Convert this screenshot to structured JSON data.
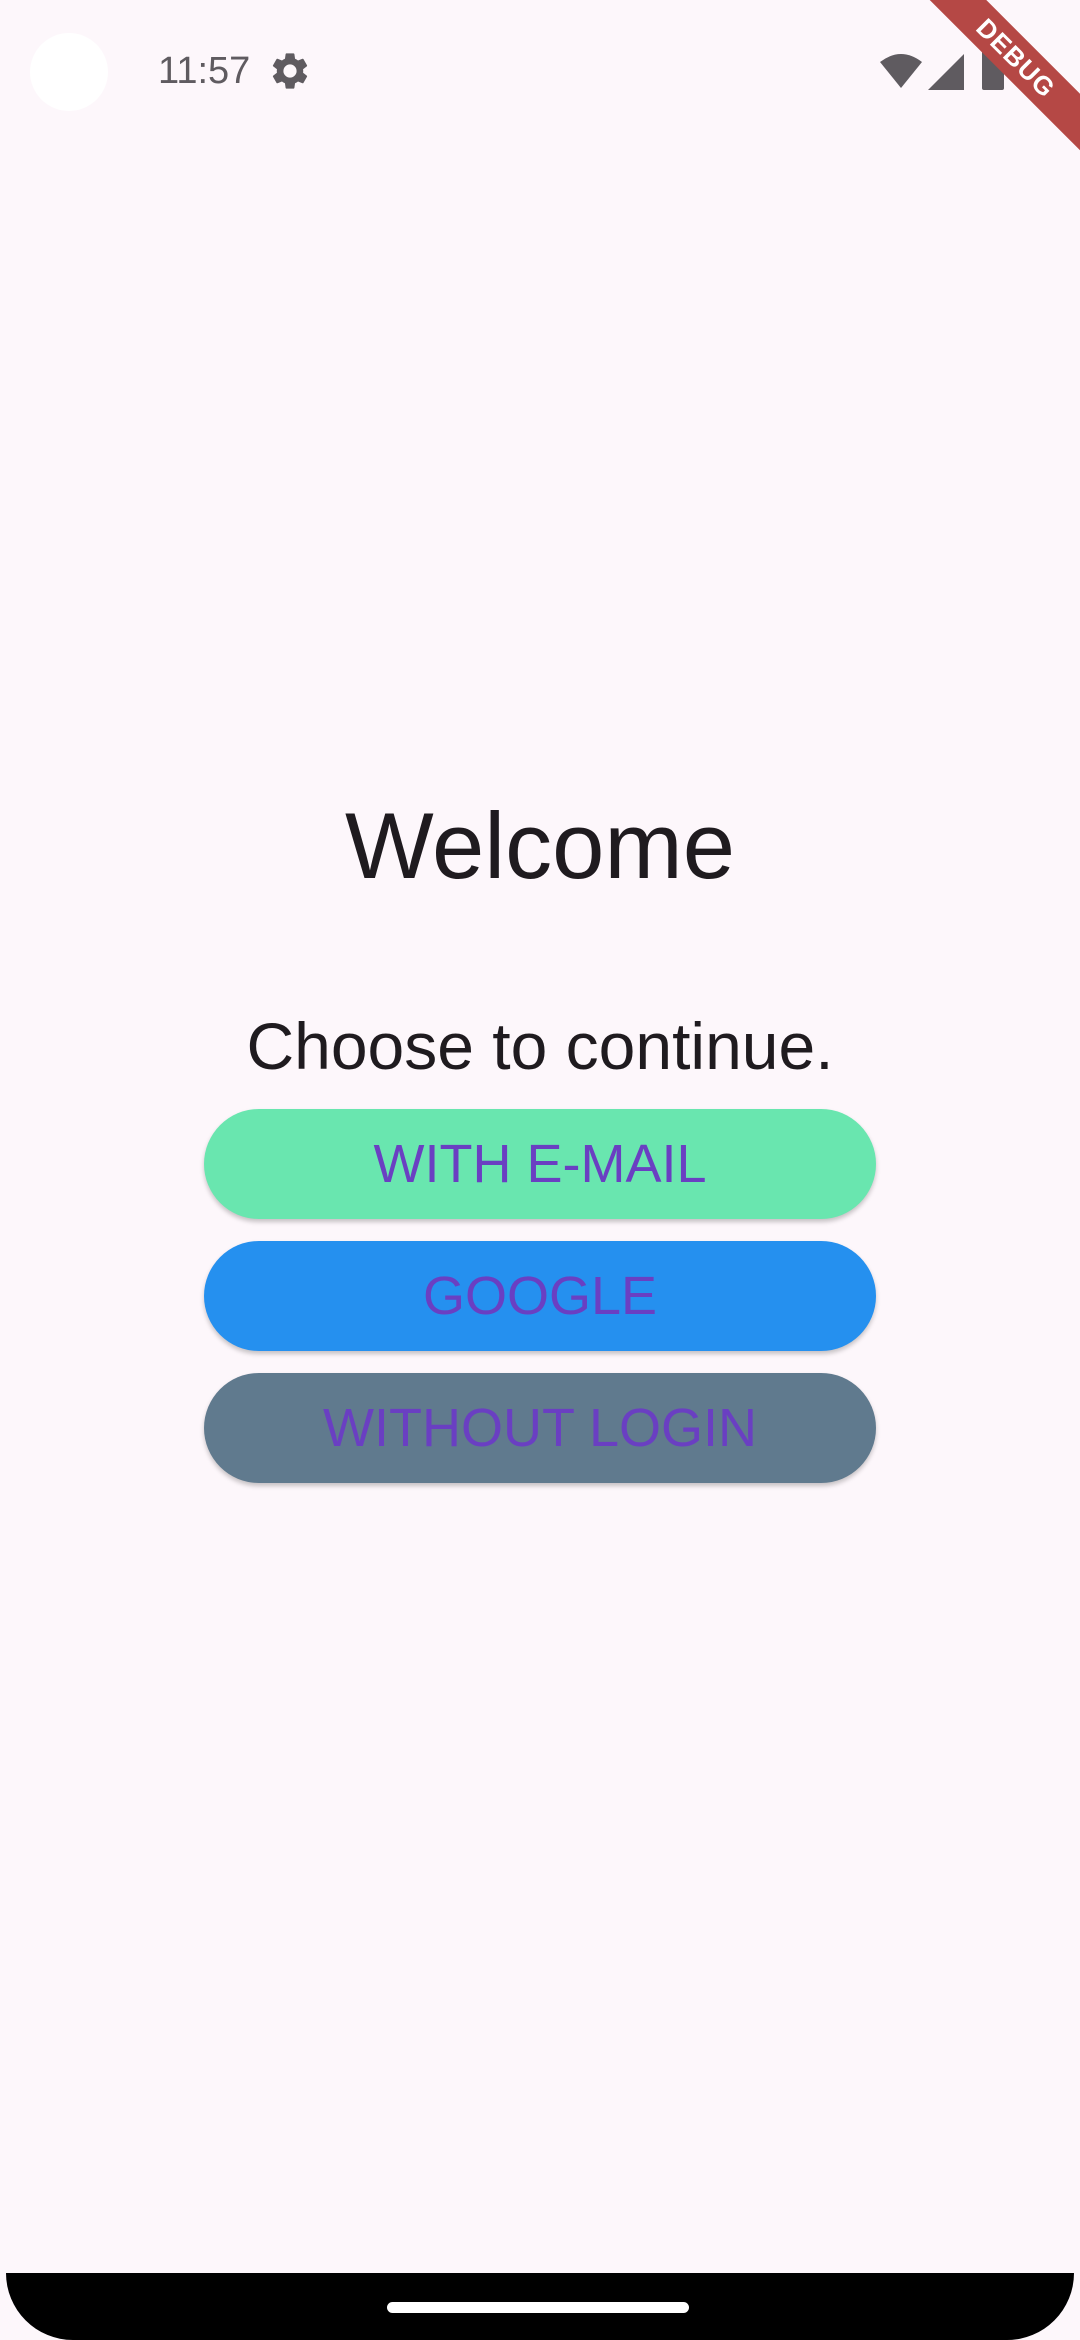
{
  "status_bar": {
    "time": "11:57",
    "icons": [
      "settings-icon",
      "wifi-icon",
      "signal-icon",
      "battery-icon"
    ]
  },
  "debug_banner": {
    "label": "DEBUG",
    "color": "#b54845"
  },
  "main": {
    "title": "Welcome",
    "subtitle": "Choose to continue.",
    "buttons": [
      {
        "label": "WITH E-MAIL",
        "color": "#69e6af"
      },
      {
        "label": "GOOGLE",
        "color": "#2590ef"
      },
      {
        "label": "WITHOUT LOGIN",
        "color": "#607a8e"
      }
    ],
    "button_text_color": "#6a3fc2"
  },
  "colors": {
    "background": "#fdf7fb",
    "text": "#1f1b1f"
  }
}
